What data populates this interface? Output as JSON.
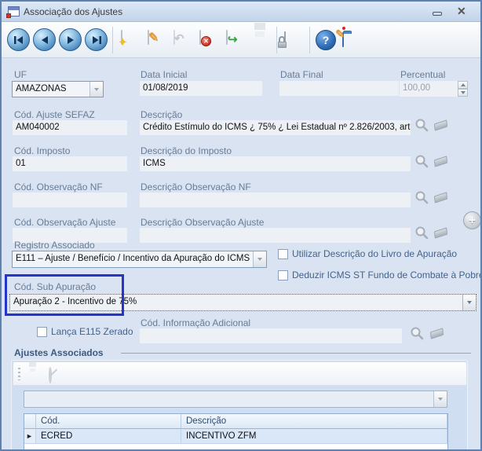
{
  "window": {
    "title": "Associação dos Ajustes"
  },
  "icons": {
    "close": "✕",
    "help": "?",
    "new_star": "✦",
    "edit_pencil": "✎",
    "undo_arrow": "↶",
    "post_arrow": "↪",
    "delete_x": "✕",
    "plus": "+",
    "folder_pencil": "✎",
    "row_selector": "►"
  },
  "form": {
    "uf": {
      "label": "UF",
      "value": "AMAZONAS"
    },
    "data_inicial": {
      "label": "Data Inicial",
      "value": "01/08/2019"
    },
    "data_final": {
      "label": "Data Final",
      "value": ""
    },
    "percentual": {
      "label": "Percentual",
      "value": "100,00"
    },
    "cod_ajuste_sefaz": {
      "label": "Cód. Ajuste SEFAZ",
      "value": "AM040002"
    },
    "descricao": {
      "label": "Descrição",
      "value": "Crédito Estímulo do ICMS ¿ 75% ¿ Lei Estadual nº 2.826/2003, art."
    },
    "cod_imposto": {
      "label": "Cód. Imposto",
      "value": "01"
    },
    "descricao_imposto": {
      "label": "Descrição do Imposto",
      "value": "ICMS"
    },
    "cod_observacao_nf": {
      "label": "Cód. Observação NF",
      "value": ""
    },
    "descricao_observacao_nf": {
      "label": "Descrição Observação NF",
      "value": ""
    },
    "cod_observacao_ajuste": {
      "label": "Cód. Observação Ajuste",
      "value": ""
    },
    "descricao_observacao_ajuste": {
      "label": "Descrição Observação Ajuste",
      "value": ""
    },
    "registro_associado": {
      "label": "Registro Associado",
      "value": "E111 – Ajuste / Benefício / Incentivo da Apuração do ICMS"
    },
    "check_livro_apuracao": {
      "label": "Utilizar Descrição do Livro de Apuração",
      "checked": false
    },
    "check_fundo_pobreza": {
      "label": "Deduzir ICMS ST Fundo de Combate à Pobreza",
      "checked": false
    },
    "cod_sub_apuracao": {
      "label": "Cód. Sub Apuração",
      "value": "Apuração 2 - Incentivo de 75%"
    },
    "check_e115": {
      "label": "Lança E115 Zerado",
      "checked": false
    },
    "cod_informacao_adicional": {
      "label": "Cód. Informação Adicional",
      "value": ""
    }
  },
  "group": {
    "title": "Ajustes Associados",
    "combo_value": "",
    "table": {
      "columns": {
        "cod": "Cód.",
        "descricao": "Descrição"
      },
      "rows": [
        {
          "cod": "ECRED",
          "descricao": "INCENTIVO ZFM"
        }
      ]
    }
  }
}
